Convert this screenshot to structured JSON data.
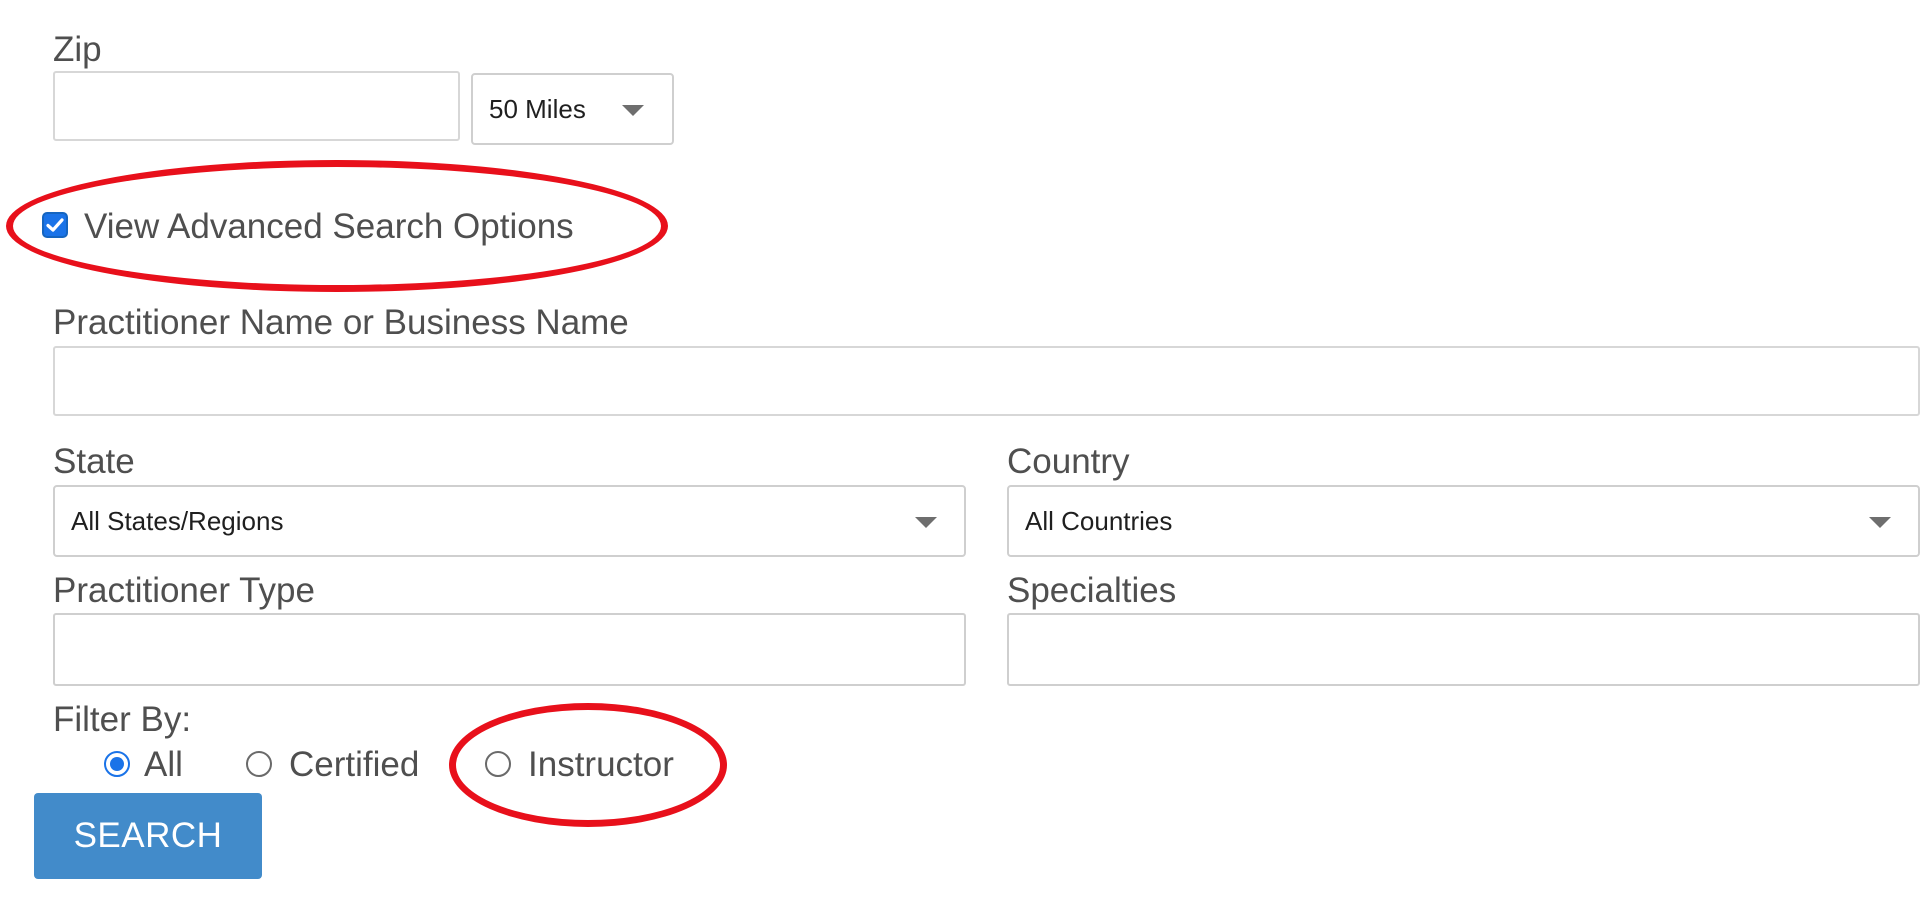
{
  "zip": {
    "label": "Zip",
    "value": "",
    "radius_selected": "50 Miles"
  },
  "advanced": {
    "label": "View Advanced Search Options",
    "checked": true
  },
  "practitioner_name": {
    "label": "Practitioner Name or Business Name",
    "value": ""
  },
  "state": {
    "label": "State",
    "selected": "All States/Regions"
  },
  "country": {
    "label": "Country",
    "selected": "All Countries"
  },
  "practitioner_type": {
    "label": "Practitioner Type",
    "value": ""
  },
  "specialties": {
    "label": "Specialties",
    "value": ""
  },
  "filter": {
    "label": "Filter By:",
    "options": [
      {
        "label": "All",
        "checked": true
      },
      {
        "label": "Certified",
        "checked": false
      },
      {
        "label": "Instructor",
        "checked": false
      }
    ]
  },
  "search_button": {
    "label": "SEARCH"
  },
  "colors": {
    "accent": "#1a73e8",
    "button": "#428bca",
    "annotation": "#e8101b"
  }
}
